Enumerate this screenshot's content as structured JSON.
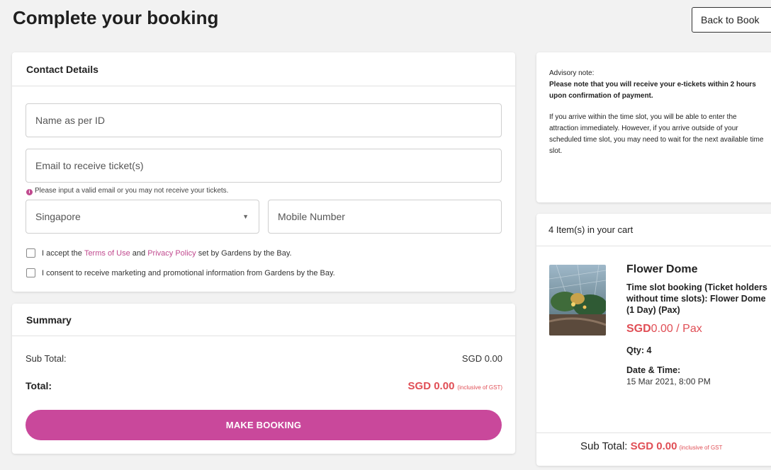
{
  "header": {
    "title": "Complete your booking",
    "back_label": "Back to Book"
  },
  "contact": {
    "heading": "Contact Details",
    "name_placeholder": "Name as per ID",
    "email_placeholder": "Email to receive ticket(s)",
    "email_note": "Please input a valid email or you may not receive your tickets.",
    "country_value": "Singapore",
    "mobile_placeholder": "Mobile Number",
    "terms_prefix": "I accept the ",
    "terms_link": "Terms of Use",
    "terms_and": " and ",
    "privacy_link": "Privacy Policy",
    "terms_suffix": " set by Gardens by the Bay.",
    "marketing_text": "I consent to receive marketing and promotional information from Gardens by the Bay."
  },
  "summary": {
    "heading": "Summary",
    "sub_total_label": "Sub Total:",
    "sub_total_value": "SGD 0.00",
    "total_label": "Total:",
    "total_value": "SGD 0.00",
    "total_note": "(inclusive of GST)",
    "button_label": "MAKE BOOKING"
  },
  "advisory": {
    "title": "Advisory note:",
    "bold_text": "Please note that you will receive your e-tickets within 2 hours upon confirmation of payment.",
    "body_text": "If you arrive within the time slot, you will be able to enter the attraction immediately. However, if you arrive outside of your scheduled time slot, you may need to wait for the next available time slot."
  },
  "cart": {
    "heading": "4 Item(s) in your cart",
    "item": {
      "title": "Flower Dome",
      "description": "Time slot booking (Ticket holders without time slots): Flower Dome (1 Day) (Pax)",
      "price_currency": "SGD",
      "price_value": "0.00 / Pax",
      "qty": "Qty: 4",
      "datetime_label": "Date & Time:",
      "datetime_value": "15 Mar 2021, 8:00 PM"
    },
    "sub_total_label": "Sub Total: ",
    "sub_total_value": "SGD 0.00",
    "sub_total_note": "(inclusive of GST"
  },
  "colors": {
    "accent": "#c9489b",
    "price": "#e04e55",
    "background": "#f2f2f2"
  }
}
